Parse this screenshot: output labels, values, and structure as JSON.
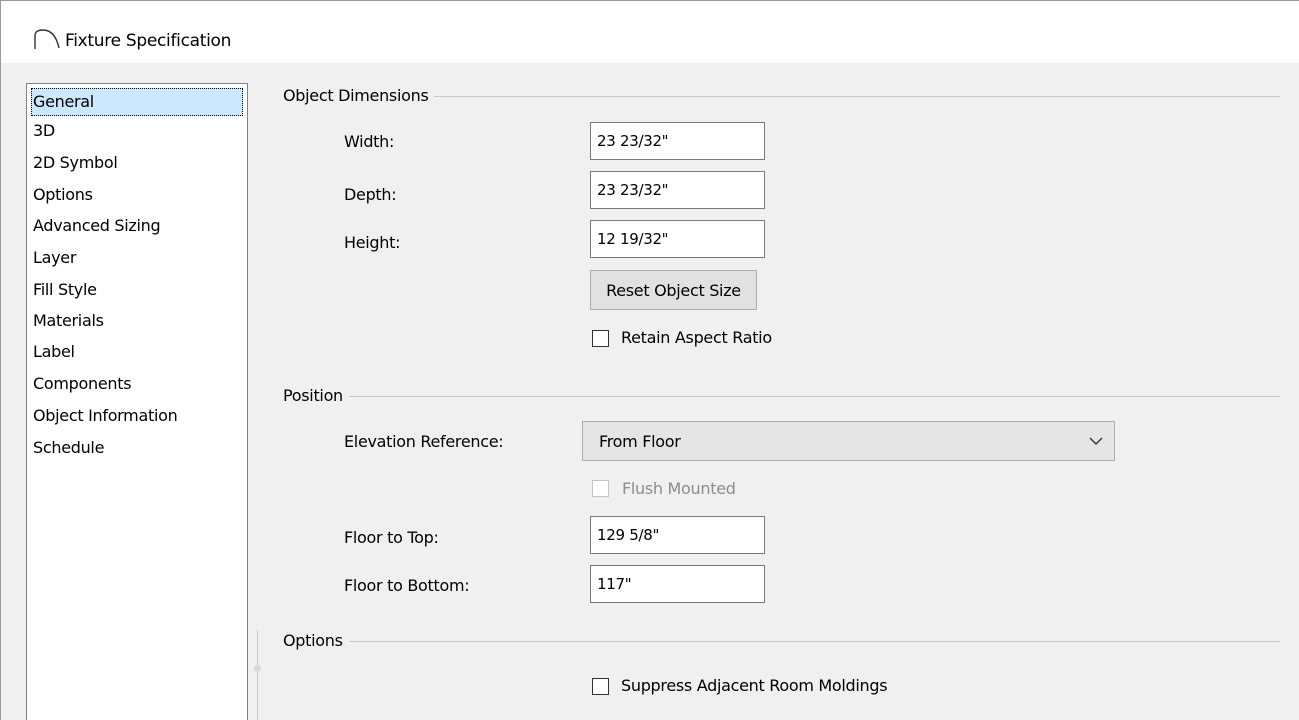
{
  "window": {
    "title": "Fixture Specification",
    "icon": "arc-icon"
  },
  "nav": {
    "items": [
      {
        "label": "General",
        "selected": true
      },
      {
        "label": "3D"
      },
      {
        "label": "2D Symbol"
      },
      {
        "label": "Options"
      },
      {
        "label": "Advanced Sizing"
      },
      {
        "label": "Layer"
      },
      {
        "label": "Fill Style"
      },
      {
        "label": "Materials"
      },
      {
        "label": "Label"
      },
      {
        "label": "Components"
      },
      {
        "label": "Object Information"
      },
      {
        "label": "Schedule"
      }
    ]
  },
  "object_dimensions": {
    "title": "Object Dimensions",
    "width_label": "Width:",
    "width_value": "23 23/32\"",
    "depth_label": "Depth:",
    "depth_value": "23 23/32\"",
    "height_label": "Height:",
    "height_value": "12 19/32\"",
    "reset_button": "Reset Object Size",
    "retain_aspect_label": "Retain Aspect Ratio",
    "retain_aspect_checked": false
  },
  "position": {
    "title": "Position",
    "elevation_label": "Elevation Reference:",
    "elevation_value": "From Floor",
    "flush_label": "Flush Mounted",
    "flush_checked": false,
    "flush_enabled": false,
    "floor_top_label": "Floor to Top:",
    "floor_top_value": "129 5/8\"",
    "floor_bottom_label": "Floor to Bottom:",
    "floor_bottom_value": "117\""
  },
  "options": {
    "title": "Options",
    "suppress_label": "Suppress Adjacent Room Moldings",
    "suppress_checked": false
  },
  "colors": {
    "background": "#f0f0f0",
    "selection": "#cce8ff",
    "disabled_text": "#8d8d8d"
  }
}
